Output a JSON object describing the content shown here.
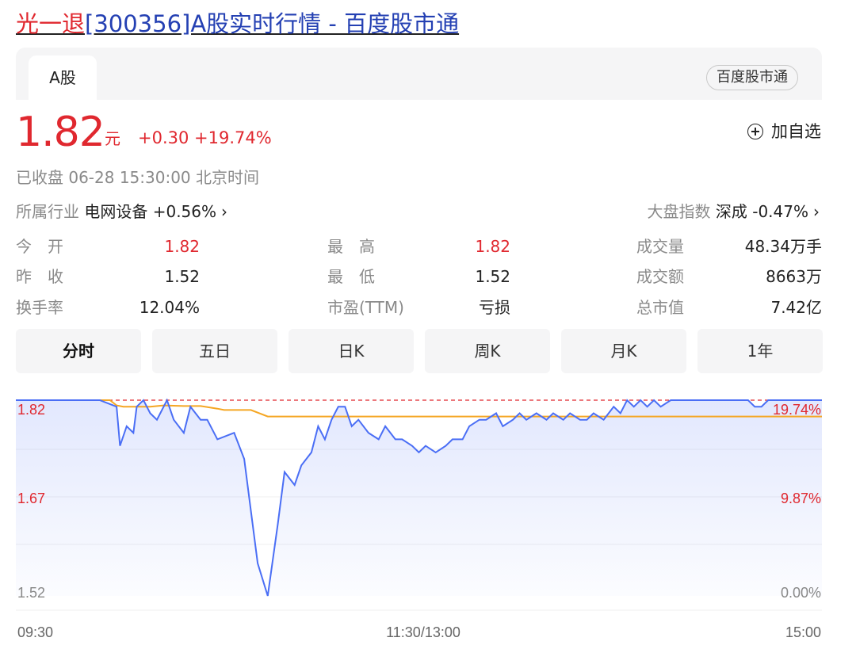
{
  "title": {
    "name": "光一退",
    "rest": "[300356]A股实时行情 - 百度股市通"
  },
  "tabs": {
    "active": "A股",
    "source_badge": "百度股市通"
  },
  "quote": {
    "price": "1.82",
    "unit": "元",
    "change": "+0.30 +19.74%",
    "add_watch": "加自选",
    "status": "已收盘  06-28 15:30:00  北京时间"
  },
  "industry": {
    "label": "所属行业",
    "name": "电网设备",
    "change": "+0.56%",
    "chev": "›"
  },
  "index": {
    "label": "大盘指数",
    "name": "深成",
    "change": "-0.47%",
    "chev": "›"
  },
  "stats": {
    "open_label": "今　开",
    "open": "1.82",
    "prev_label": "昨　收",
    "prev": "1.52",
    "turnover_label": "换手率",
    "turnover": "12.04%",
    "high_label": "最　高",
    "high": "1.82",
    "low_label": "最　低",
    "low": "1.52",
    "pe_label": "市盈(TTM)",
    "pe": "亏损",
    "volume_label": "成交量",
    "volume": "48.34万手",
    "amount_label": "成交额",
    "amount": "8663万",
    "mcap_label": "总市值",
    "mcap": "7.42亿"
  },
  "periods": [
    "分时",
    "五日",
    "日K",
    "周K",
    "月K",
    "1年"
  ],
  "colors": {
    "up": "#e0282f",
    "price_line": "#4a6ef5",
    "avg_line": "#f5a623",
    "link": "#2440b3"
  },
  "chart_data": {
    "type": "line",
    "ylim": [
      1.52,
      1.82
    ],
    "y_ticks_left": [
      "1.82",
      "1.67",
      "1.52"
    ],
    "y_ticks_right": [
      "19.74%",
      "9.87%",
      "0.00%"
    ],
    "x_ticks": [
      "09:30",
      "11:30/13:00",
      "15:00"
    ],
    "reference_line": 1.82,
    "series": [
      {
        "role": "price",
        "x": [
          0,
          10,
          25,
          30,
          31,
          33,
          35,
          36,
          38,
          40,
          42,
          45,
          47,
          50,
          52,
          55,
          57,
          60,
          65,
          68,
          70,
          72,
          75,
          78,
          80,
          83,
          85,
          88,
          90,
          92,
          94,
          96,
          98,
          100,
          102,
          105,
          108,
          110,
          113,
          115,
          118,
          120,
          122,
          125,
          128,
          130,
          133,
          135,
          138,
          140,
          143,
          145,
          148,
          150,
          152,
          155,
          158,
          160,
          163,
          165,
          168,
          170,
          172,
          175,
          178,
          180,
          182,
          184,
          186,
          188,
          190,
          192,
          195,
          200,
          205,
          210,
          215,
          218,
          220,
          222,
          224,
          230,
          235,
          240
        ],
        "y": [
          1.82,
          1.82,
          1.82,
          1.81,
          1.75,
          1.78,
          1.77,
          1.81,
          1.82,
          1.8,
          1.79,
          1.82,
          1.79,
          1.77,
          1.81,
          1.79,
          1.79,
          1.76,
          1.77,
          1.73,
          1.65,
          1.57,
          1.52,
          1.63,
          1.71,
          1.69,
          1.72,
          1.74,
          1.78,
          1.76,
          1.79,
          1.81,
          1.81,
          1.78,
          1.79,
          1.77,
          1.76,
          1.78,
          1.76,
          1.76,
          1.75,
          1.74,
          1.75,
          1.74,
          1.75,
          1.76,
          1.76,
          1.78,
          1.79,
          1.79,
          1.8,
          1.78,
          1.79,
          1.8,
          1.79,
          1.8,
          1.79,
          1.8,
          1.79,
          1.8,
          1.79,
          1.79,
          1.8,
          1.79,
          1.81,
          1.8,
          1.82,
          1.81,
          1.82,
          1.81,
          1.82,
          1.81,
          1.82,
          1.82,
          1.82,
          1.82,
          1.82,
          1.82,
          1.81,
          1.81,
          1.82,
          1.82,
          1.82,
          1.82
        ]
      },
      {
        "role": "average",
        "x": [
          0,
          28,
          30,
          32,
          40,
          44,
          50,
          55,
          60,
          62,
          65,
          70,
          75,
          100,
          240
        ],
        "y": [
          1.82,
          1.82,
          1.812,
          1.81,
          1.81,
          1.812,
          1.811,
          1.811,
          1.807,
          1.805,
          1.805,
          1.805,
          1.795,
          1.795,
          1.795
        ]
      }
    ]
  }
}
